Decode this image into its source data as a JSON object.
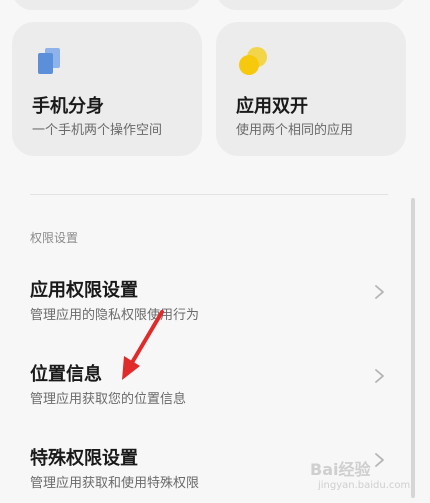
{
  "cards": [
    {
      "title": "手机分身",
      "subtitle": "一个手机两个操作空间",
      "icon": "phone-clone-icon"
    },
    {
      "title": "应用双开",
      "subtitle": "使用两个相同的应用",
      "icon": "dual-apps-icon"
    }
  ],
  "section": {
    "header": "权限设置"
  },
  "items": [
    {
      "title": "应用权限设置",
      "subtitle": "管理应用的隐私权限使用行为"
    },
    {
      "title": "位置信息",
      "subtitle": "管理应用获取您的位置信息"
    },
    {
      "title": "特殊权限设置",
      "subtitle": "管理应用获取和使用特殊权限"
    }
  ],
  "watermark": {
    "text": "Bai经验",
    "url": "jingyan.baidu.com"
  },
  "colors": {
    "clone_icon": "#5b8fd9",
    "dual_icon": "#f7c90c",
    "arrow": "#e12b2b"
  }
}
